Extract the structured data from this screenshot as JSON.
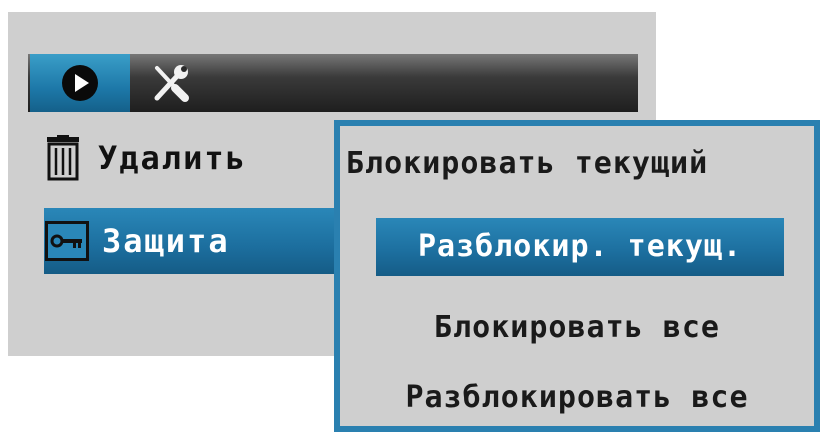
{
  "tabs": [
    {
      "icon": "play-icon",
      "selected": true
    },
    {
      "icon": "wrench-screwdriver-icon",
      "selected": false
    }
  ],
  "menu": {
    "items": [
      {
        "icon": "trash-icon",
        "label": "Удалить",
        "selected": false
      },
      {
        "icon": "key-icon",
        "label": "Защита",
        "selected": true
      }
    ]
  },
  "submenu": {
    "items": [
      {
        "label": "Блокировать текущий",
        "selected": false
      },
      {
        "label": "Разблокир. текущ.",
        "selected": true
      },
      {
        "label": "Блокировать все",
        "selected": false
      },
      {
        "label": "Разблокировать все",
        "selected": false
      }
    ]
  },
  "colors": {
    "accent": "#1c6e9e",
    "panel": "#cfcfcf",
    "tabbar": "#2a2a2a"
  }
}
